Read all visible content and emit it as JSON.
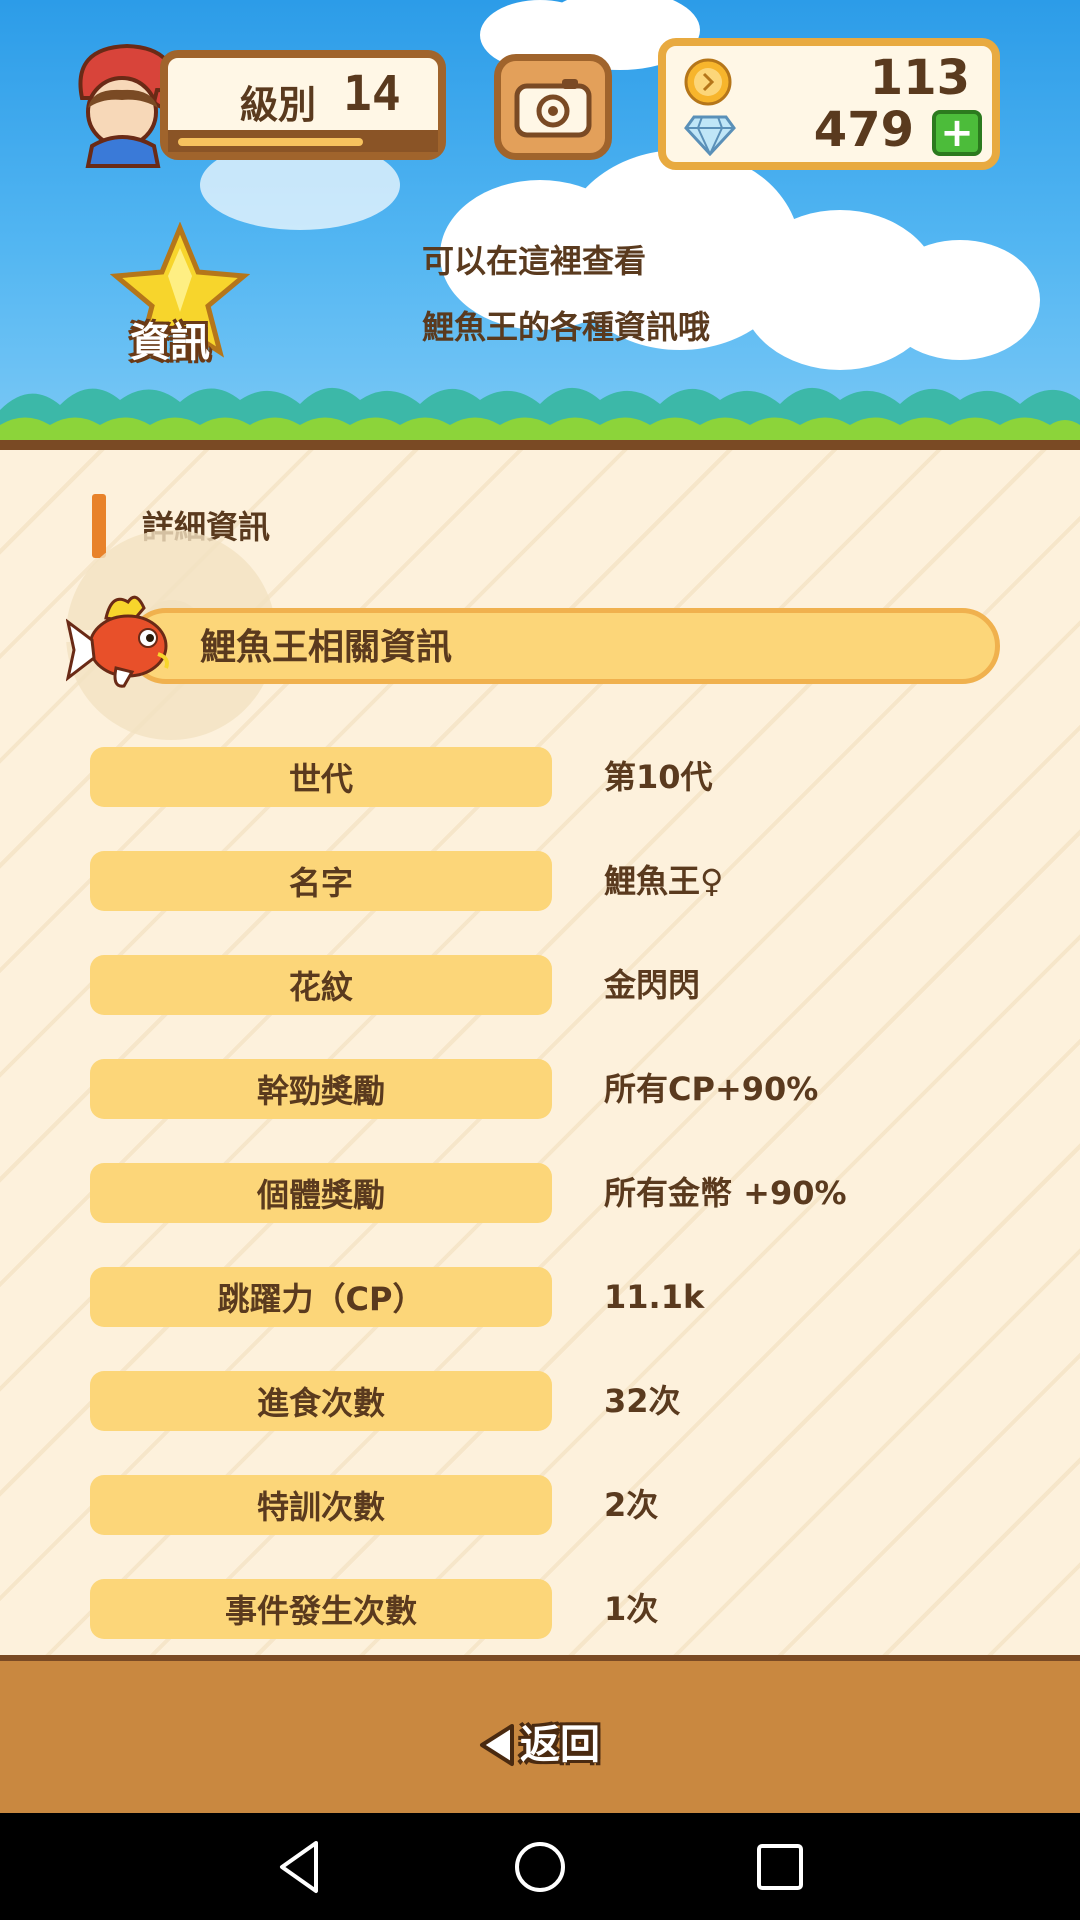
{
  "header": {
    "level_label": "級別",
    "level_value": "14",
    "level_progress": 0.74,
    "coins": "113",
    "gems": "479",
    "plus_label": "+",
    "badge_label": "資訊",
    "info_line1": "可以在這裡查看",
    "info_line2": "鯉魚王的各種資訊哦"
  },
  "details": {
    "section_title": "詳細資訊",
    "banner_title": "鯉魚王相關資訊",
    "rows": [
      {
        "label": "世代",
        "value": "第10代"
      },
      {
        "label": "名字",
        "value": "鯉魚王♀"
      },
      {
        "label": "花紋",
        "value": "金閃閃"
      },
      {
        "label": "幹勁獎勵",
        "value": "所有CP+90%"
      },
      {
        "label": "個體獎勵",
        "value": "所有金幣 +90%"
      },
      {
        "label": "跳躍力（CP）",
        "value": "11.1k"
      },
      {
        "label": "進食次數",
        "value": "32次"
      },
      {
        "label": "特訓次數",
        "value": "2次"
      },
      {
        "label": "事件發生次數",
        "value": "1次"
      }
    ]
  },
  "footer": {
    "back_label": "返回"
  },
  "icons": {
    "camera": "camera-icon",
    "coin": "coin-icon",
    "gem": "diamond-icon",
    "star": "star-icon",
    "nav_back": "triangle-back-icon",
    "nav_home": "circle-home-icon",
    "nav_recent": "square-recents-icon"
  },
  "colors": {
    "sky": "#2c9ce8",
    "label_bg": "#fcd679",
    "text": "#5a3a1e",
    "bottom_bar": "#c98840",
    "accent": "#e8822a"
  }
}
